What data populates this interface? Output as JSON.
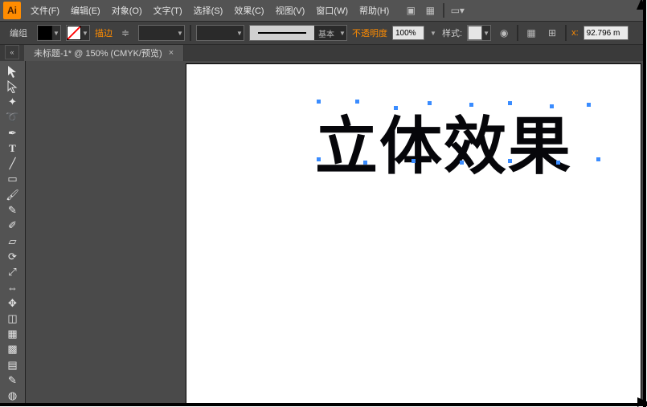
{
  "app_logo": "Ai",
  "menu": {
    "file": "文件(F)",
    "edit": "编辑(E)",
    "object": "对象(O)",
    "text": "文字(T)",
    "select": "选择(S)",
    "effect": "效果(C)",
    "view": "视图(V)",
    "window": "窗口(W)",
    "help": "帮助(H)"
  },
  "control": {
    "group_label": "编组",
    "stroke_label": "描边",
    "stroke_weight": "",
    "brush_label": "基本",
    "opacity_label": "不透明度",
    "opacity_value": "100%",
    "style_label": "样式:",
    "coord_label_x": "x:",
    "coord_value": "92.796 m"
  },
  "docTab": {
    "title": "未标题-1* @ 150% (CMYK/预览)",
    "close": "×"
  },
  "tools": {
    "selection": "selection-tool",
    "direct": "direct-selection-tool",
    "wand": "magic-wand-tool",
    "lasso": "lasso-tool",
    "pen": "pen-tool",
    "type": "type-tool",
    "line": "line-tool",
    "rect": "rectangle-tool",
    "brush": "paintbrush-tool",
    "pencil": "pencil-tool",
    "blob": "blob-brush-tool",
    "eraser": "eraser-tool",
    "rotate": "rotate-tool",
    "scale": "scale-tool",
    "width": "width-tool",
    "free": "free-transform-tool",
    "shape": "shape-builder-tool",
    "perspective": "perspective-grid-tool",
    "mesh": "mesh-tool",
    "gradient": "gradient-tool",
    "eyedrop": "eyedropper-tool",
    "blend": "blend-tool"
  },
  "canvas": {
    "text": "立体效果"
  },
  "colors": {
    "accent": "#ff8c00",
    "panel": "#535353"
  }
}
